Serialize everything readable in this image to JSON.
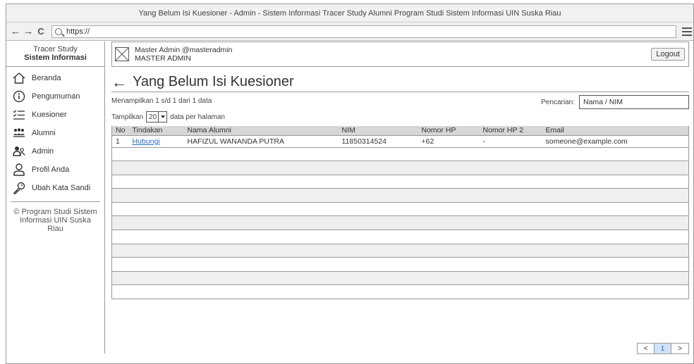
{
  "window": {
    "title": "Yang Belum Isi Kuesioner - Admin - Sistem Informasi Tracer Study Alumni Program Studi Sistem Informasi UIN Suska Riau"
  },
  "browser": {
    "back": "←",
    "forward": "→",
    "reload": "C",
    "url": "https://"
  },
  "brand": {
    "line1": "Tracer Study",
    "line2": "Sistem Informasi"
  },
  "menu": [
    {
      "label": "Beranda",
      "icon": "home-icon"
    },
    {
      "label": "Pengumuman",
      "icon": "info-icon"
    },
    {
      "label": "Kuesioner",
      "icon": "checklist-icon"
    },
    {
      "label": "Alumni",
      "icon": "users-icon"
    },
    {
      "label": "Admin",
      "icon": "admin-icon"
    },
    {
      "label": "Profil Anda",
      "icon": "user-icon"
    },
    {
      "label": "Ubah Kata Sandi",
      "icon": "key-icon"
    }
  ],
  "copyright": {
    "line1": "© Program Studi Sistem",
    "line2": "Informasi UIN Suska",
    "line3": "Riau"
  },
  "user": {
    "name": "Master Admin @masteradmin",
    "role": "MASTER ADMIN",
    "logout_label": "Logout"
  },
  "page": {
    "title": "Yang Belum Isi Kuesioner",
    "back_icon": "←"
  },
  "listing": {
    "summary": "Menampilkan 1 s/d 1 dari 1 data",
    "search_label": "Pencarian:",
    "search_placeholder": "Nama / NIM",
    "perpage_prefix": "Tampilkan",
    "perpage_value": "20",
    "perpage_suffix": "data per halaman"
  },
  "table": {
    "headers": [
      "No",
      "Tindakan",
      "Nama Alumni",
      "NIM",
      "Nomor HP",
      "Nomor HP 2",
      "Email"
    ],
    "rows": [
      {
        "no": "1",
        "action": "Hubungi",
        "name": "HAFIZUL WANANDA PUTRA",
        "nim": "11850314524",
        "hp": "+62",
        "hp2": "-",
        "email": "someone@example.com"
      }
    ]
  },
  "pagination": {
    "prev": "<",
    "current": "1",
    "next": ">"
  },
  "colors": {
    "link": "#2b6cc4",
    "header_bg": "#d6d6d6",
    "alt_row": "#efefef",
    "border": "#999999"
  }
}
